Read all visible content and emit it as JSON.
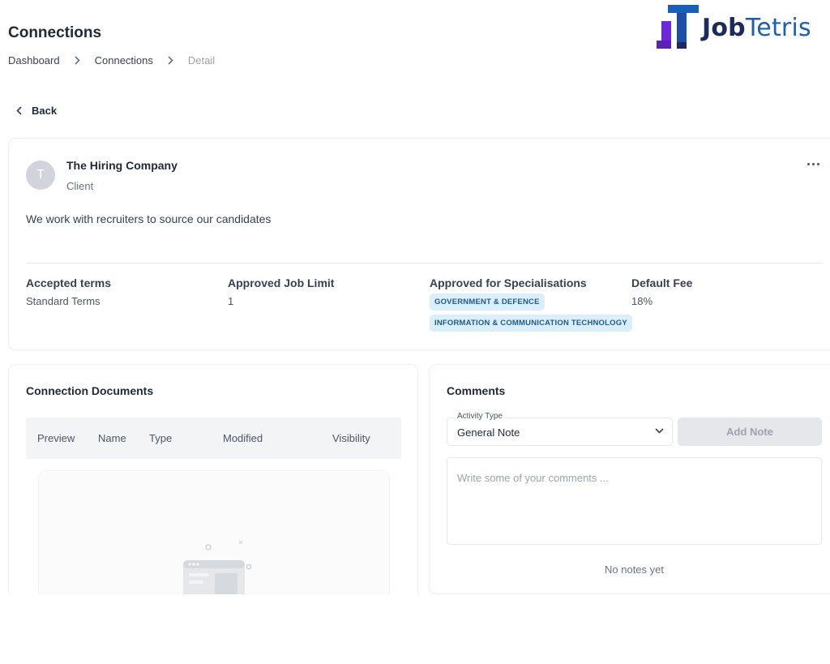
{
  "header": {
    "title": "Connections",
    "breadcrumb": [
      "Dashboard",
      "Connections",
      "Detail"
    ]
  },
  "brand": {
    "name_part1": "Job",
    "name_part2": "Tetris",
    "colors": {
      "navy": "#1e2a5a",
      "blue": "#1b5fb7",
      "purple": "#6d28d9"
    }
  },
  "back_label": "Back",
  "client": {
    "avatar_initial": "T",
    "name": "The Hiring Company",
    "role": "Client",
    "description": "We work with recruiters to source our candidates",
    "more_icon": "ellipsis-icon",
    "details": {
      "accepted_terms": {
        "label": "Accepted terms",
        "value": "Standard Terms"
      },
      "job_limit": {
        "label": "Approved Job Limit",
        "value": "1"
      },
      "specialisations": {
        "label": "Approved for Specialisations",
        "tags": [
          "GOVERNMENT & DEFENCE",
          "INFORMATION & COMMUNICATION TECHNOLOGY"
        ]
      },
      "default_fee": {
        "label": "Default Fee",
        "value": "18%"
      }
    }
  },
  "documents": {
    "title": "Connection Documents",
    "columns": [
      "Preview",
      "Name",
      "Type",
      "Modified",
      "Visibility"
    ]
  },
  "comments": {
    "title": "Comments",
    "activity_type_label": "Activity Type",
    "activity_type_value": "General Note",
    "add_note_label": "Add Note",
    "placeholder": "Write some of your comments ...",
    "empty_text": "No notes yet"
  }
}
